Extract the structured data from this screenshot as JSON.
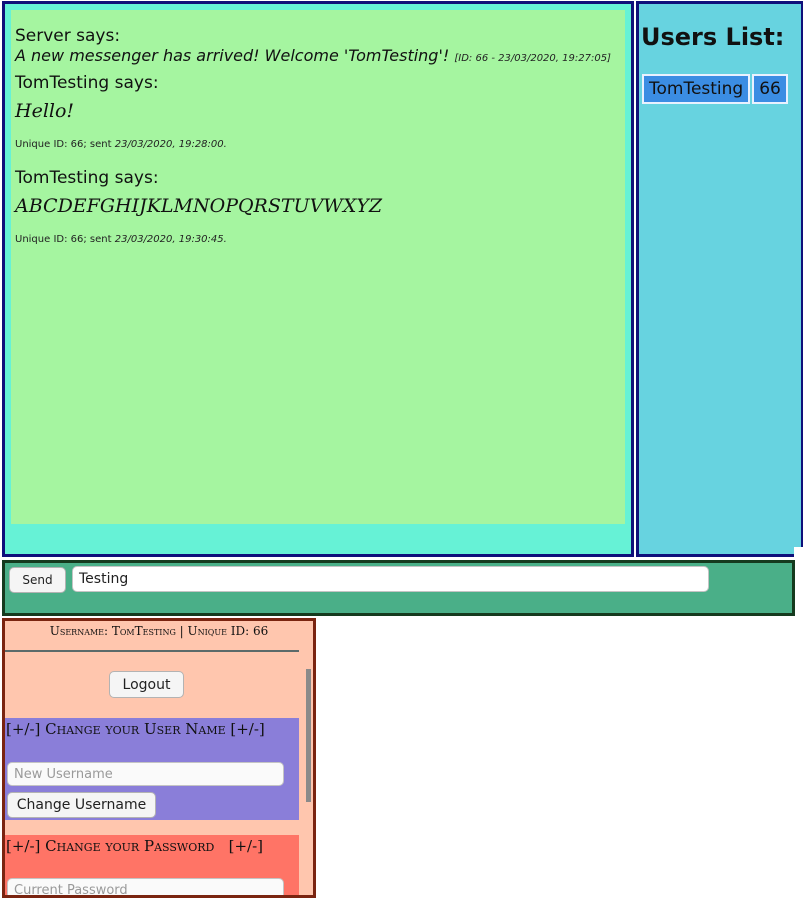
{
  "chat": {
    "server_message": {
      "author": "Server says:",
      "text": "A new messenger has arrived! Welcome 'TomTesting'!",
      "meta": "[ID: 66 - 23/03/2020, 19:27:05]"
    },
    "messages": [
      {
        "author": "TomTesting says:",
        "body": "Hello!",
        "footer_prefix": "Unique ID: 66; sent",
        "footer_time": "23/03/2020, 19:28:00."
      },
      {
        "author": "TomTesting says:",
        "body": "ABCDEFGHIJKLMNOPQRSTUVWXYZ",
        "footer_prefix": "Unique ID: 66; sent",
        "footer_time": "23/03/2020, 19:30:45."
      }
    ]
  },
  "users": {
    "title": "Users List:",
    "list": [
      {
        "name": "TomTesting",
        "id": "66"
      }
    ]
  },
  "send_bar": {
    "send_label": "Send",
    "message_value": "Testing"
  },
  "account": {
    "header": "Username: TomTesting | Unique ID: 66",
    "logout_label": "Logout",
    "change_username": {
      "title": "[+/-] Change your User Name [+/-]",
      "placeholder": "New Username",
      "button_label": "Change Username"
    },
    "change_password": {
      "title": "[+/-] Change your Password   [+/-]",
      "placeholder": "Current Password"
    }
  },
  "colors": {
    "chat_bg": "#a5f5a0",
    "chat_frame": "#66f2d6",
    "users_bg": "#67d3e0",
    "send_bar_bg": "#4aaf88",
    "account_bg": "#ffc6ae",
    "username_section_bg": "#8a7ed9",
    "password_section_bg": "#ff7466",
    "user_cell_bg": "#3b8de3"
  }
}
